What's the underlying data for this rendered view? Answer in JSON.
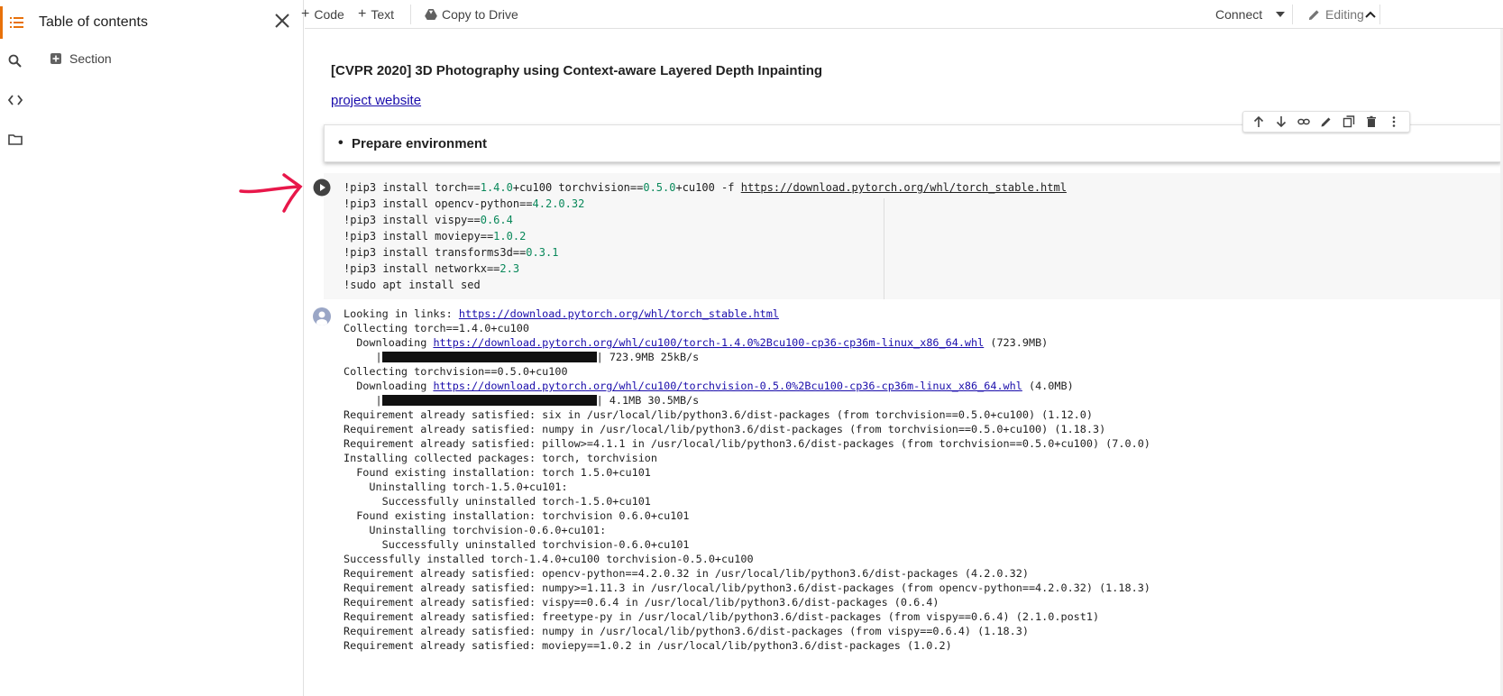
{
  "sidebar": {
    "title": "Table of contents",
    "items": [
      {
        "label": "Section"
      }
    ],
    "rail_icons": [
      "toc-icon",
      "search-icon",
      "code-snippets-icon",
      "folder-icon"
    ]
  },
  "toolbar": {
    "code_label": "Code",
    "text_label": "Text",
    "copy_label": "Copy to Drive",
    "connect_label": "Connect",
    "editing_label": "Editing"
  },
  "notebook": {
    "title": "[CVPR 2020] 3D Photography using Context-aware Layered Depth Inpainting",
    "link_text": "project website",
    "section_bullet": "Prepare environment",
    "code_cell": {
      "lines": [
        [
          "!pip3 install torch==",
          "1.4.0",
          "+cu100 torchvision==",
          "0.5.0",
          "+cu100 -f ",
          "https://download.pytorch.org/whl/torch_stable.html"
        ],
        [
          "!pip3 install opencv-python==",
          "4.2.0.32"
        ],
        [
          "!pip3 install vispy==",
          "0.6.4"
        ],
        [
          "!pip3 install moviepy==",
          "1.0.2"
        ],
        [
          "!pip3 install transforms3d==",
          "0.3.1"
        ],
        [
          "!pip3 install networkx==",
          "2.3"
        ],
        [
          "!sudo apt install sed"
        ]
      ]
    },
    "output": {
      "lines": [
        {
          "text": "Looking in links: ",
          "link": "https://download.pytorch.org/whl/torch_stable.html"
        },
        {
          "text": "Collecting torch==1.4.0+cu100"
        },
        {
          "text": "  Downloading ",
          "link": "https://download.pytorch.org/whl/cu100/torch-1.4.0%2Bcu100-cp36-cp36m-linux_x86_64.whl",
          "after": " (723.9MB)"
        },
        {
          "progress": true,
          "prefix": "     |",
          "after": "| 723.9MB 25kB/s"
        },
        {
          "text": "Collecting torchvision==0.5.0+cu100"
        },
        {
          "text": "  Downloading ",
          "link": "https://download.pytorch.org/whl/cu100/torchvision-0.5.0%2Bcu100-cp36-cp36m-linux_x86_64.whl",
          "after": " (4.0MB)"
        },
        {
          "progress": true,
          "prefix": "     |",
          "after": "| 4.1MB 30.5MB/s"
        },
        {
          "text": "Requirement already satisfied: six in /usr/local/lib/python3.6/dist-packages (from torchvision==0.5.0+cu100) (1.12.0)"
        },
        {
          "text": "Requirement already satisfied: numpy in /usr/local/lib/python3.6/dist-packages (from torchvision==0.5.0+cu100) (1.18.3)"
        },
        {
          "text": "Requirement already satisfied: pillow>=4.1.1 in /usr/local/lib/python3.6/dist-packages (from torchvision==0.5.0+cu100) (7.0.0)"
        },
        {
          "text": "Installing collected packages: torch, torchvision"
        },
        {
          "text": "  Found existing installation: torch 1.5.0+cu101"
        },
        {
          "text": "    Uninstalling torch-1.5.0+cu101:"
        },
        {
          "text": "      Successfully uninstalled torch-1.5.0+cu101"
        },
        {
          "text": "  Found existing installation: torchvision 0.6.0+cu101"
        },
        {
          "text": "    Uninstalling torchvision-0.6.0+cu101:"
        },
        {
          "text": "      Successfully uninstalled torchvision-0.6.0+cu101"
        },
        {
          "text": "Successfully installed torch-1.4.0+cu100 torchvision-0.5.0+cu100"
        },
        {
          "text": "Requirement already satisfied: opencv-python==4.2.0.32 in /usr/local/lib/python3.6/dist-packages (4.2.0.32)"
        },
        {
          "text": "Requirement already satisfied: numpy>=1.11.3 in /usr/local/lib/python3.6/dist-packages (from opencv-python==4.2.0.32) (1.18.3)"
        },
        {
          "text": "Requirement already satisfied: vispy==0.6.4 in /usr/local/lib/python3.6/dist-packages (0.6.4)"
        },
        {
          "text": "Requirement already satisfied: freetype-py in /usr/local/lib/python3.6/dist-packages (from vispy==0.6.4) (2.1.0.post1)"
        },
        {
          "text": "Requirement already satisfied: numpy in /usr/local/lib/python3.6/dist-packages (from vispy==0.6.4) (1.18.3)"
        },
        {
          "text": "Requirement already satisfied: moviepy==1.0.2 in /usr/local/lib/python3.6/dist-packages (1.0.2)"
        }
      ]
    }
  },
  "colors": {
    "accent": "#e8710a",
    "link": "#1a0dab",
    "number": "#09885a",
    "annotation_arrow": "#e8174a"
  }
}
